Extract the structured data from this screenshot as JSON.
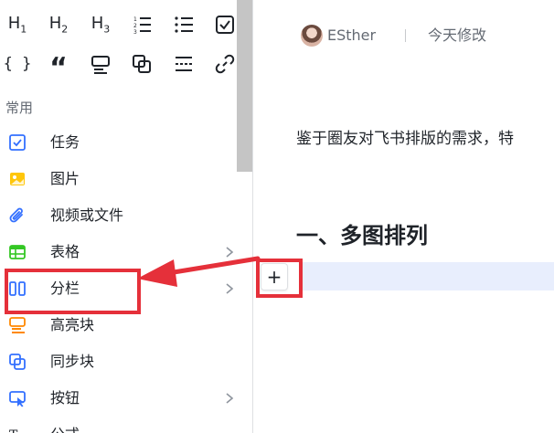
{
  "format_toolbar": {
    "row1": [
      "H1",
      "H2",
      "H3",
      "ordered-list",
      "bullet-list",
      "checkbox"
    ],
    "row2": [
      "code-block",
      "quote",
      "callout",
      "sync-block",
      "divider",
      "link"
    ],
    "h1_label": "H",
    "h2_label": "H",
    "h3_label": "H",
    "h1_sub": "1",
    "h2_sub": "2",
    "h3_sub": "3",
    "code_label": "{ }",
    "quote_label": "“"
  },
  "menu": {
    "section_label": "常用",
    "items": [
      {
        "label": "任务",
        "icon": "task-checkbox-icon",
        "submenu": false,
        "color": "#3370ff"
      },
      {
        "label": "图片",
        "icon": "image-icon",
        "submenu": false,
        "color": "#ffc60a"
      },
      {
        "label": "视频或文件",
        "icon": "attachment-icon",
        "submenu": false,
        "color": "#3370ff"
      },
      {
        "label": "表格",
        "icon": "table-icon",
        "submenu": true,
        "color": "#34c724"
      },
      {
        "label": "分栏",
        "icon": "columns-icon",
        "submenu": true,
        "color": "#3370ff"
      },
      {
        "label": "高亮块",
        "icon": "highlight-block-icon",
        "submenu": false,
        "color": "#ff8800"
      },
      {
        "label": "同步块",
        "icon": "sync-block-icon",
        "submenu": false,
        "color": "#3370ff"
      },
      {
        "label": "按钮",
        "icon": "button-icon",
        "submenu": true,
        "color": "#3370ff"
      },
      {
        "label": "公式",
        "icon": "formula-icon",
        "submenu": false,
        "color": "#1f2329"
      }
    ]
  },
  "doc": {
    "author": "ESther",
    "modified": "今天修改",
    "paragraph": "鉴于圈友对飞书排版的需求，特",
    "heading": "一、多图排列",
    "add_button_label": "+"
  },
  "annotation": {
    "color": "#e5303a"
  }
}
